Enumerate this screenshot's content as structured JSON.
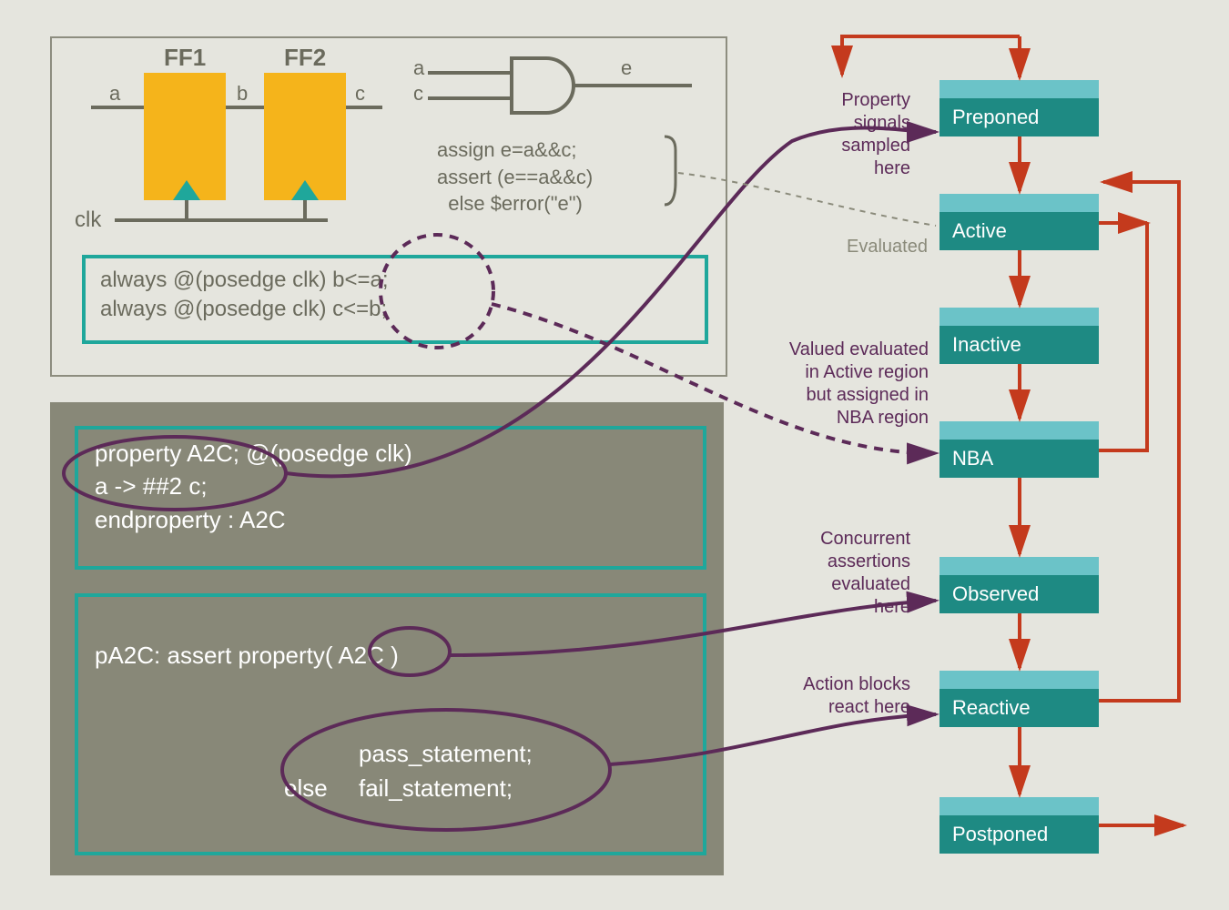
{
  "circuit": {
    "ff1": "FF1",
    "ff2": "FF2",
    "sig_a": "a",
    "sig_b": "b",
    "sig_c": "c",
    "sig_e": "e",
    "clk": "clk",
    "assign_block": "assign e=a&&c;\nassert (e==a&&c)\n  else $error(\"e\")",
    "always_block": "always @(posedge clk) b<=a;\nalways @(posedge clk) c<=b;"
  },
  "property_block": {
    "code": "property A2C; @(posedge clk)\na -> ##2 c;\nendproperty : A2C"
  },
  "assert_block": {
    "line1": "pA2C: assert property( A2C )",
    "pass": "pass_statement;",
    "else_kw": "else",
    "fail": "fail_statement;"
  },
  "regions": {
    "r1": "Preponed",
    "r2": "Active",
    "r3": "Inactive",
    "r4": "NBA",
    "r5": "Observed",
    "r6": "Reactive",
    "r7": "Postponed"
  },
  "annotations": {
    "preponed": "Property\nsignals\nsampled\nhere",
    "evaluated": "Evaluated",
    "nba": "Valued evaluated\nin Active region\nbut assigned in\nNBA region",
    "observed": "Concurrent\nassertions\nevaluated\nhere",
    "reactive": "Action blocks\nreact here"
  }
}
